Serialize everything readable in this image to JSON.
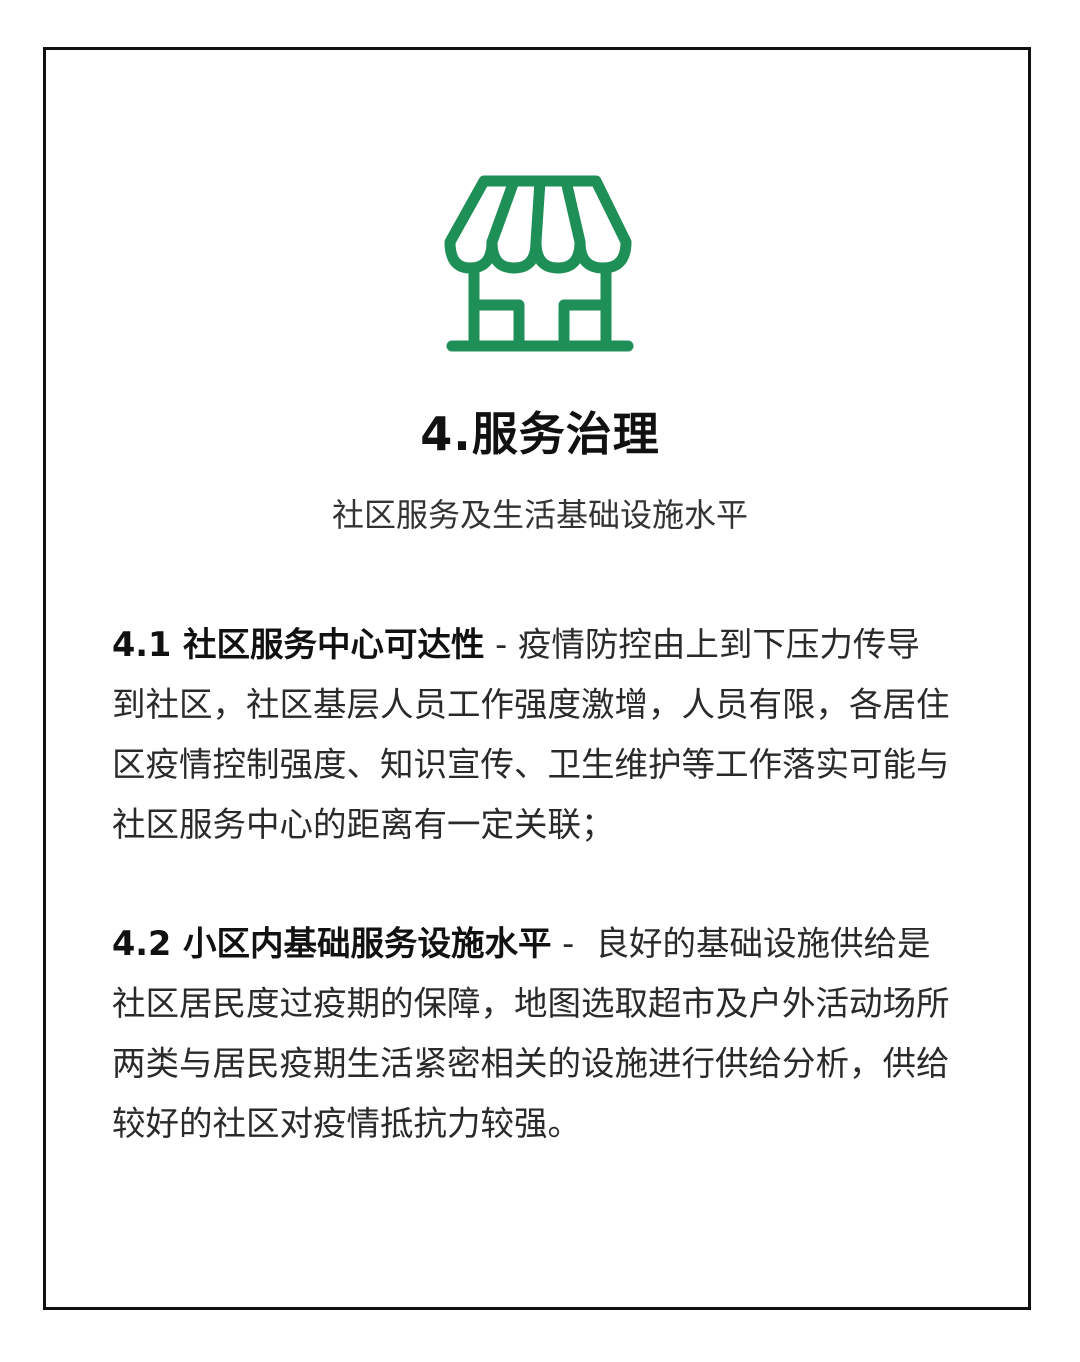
{
  "title": "4.服务治理",
  "subtitle": "社区服务及生活基础设施水平",
  "sections": [
    {
      "heading": "4.1 社区服务中心可达性",
      "separator": " - ",
      "body": "疫情防控由上到下压力传导到社区，社区基层人员工作强度激增，人员有限，各居住区疫情控制强度、知识宣传、卫生维护等工作落实可能与社区服务中心的距离有一定关联；"
    },
    {
      "heading": "4.2 小区内基础服务设施水平",
      "separator": " -  ",
      "body": "良好的基础设施供给是社区居民度过疫期的保障，地图选取超市及户外活动场所两类与居民疫期生活紧密相关的设施进行供给分析，供给较好的社区对疫情抵抗力较强。"
    }
  ],
  "icon": {
    "name": "storefront-icon",
    "color": "#1e8f57"
  }
}
